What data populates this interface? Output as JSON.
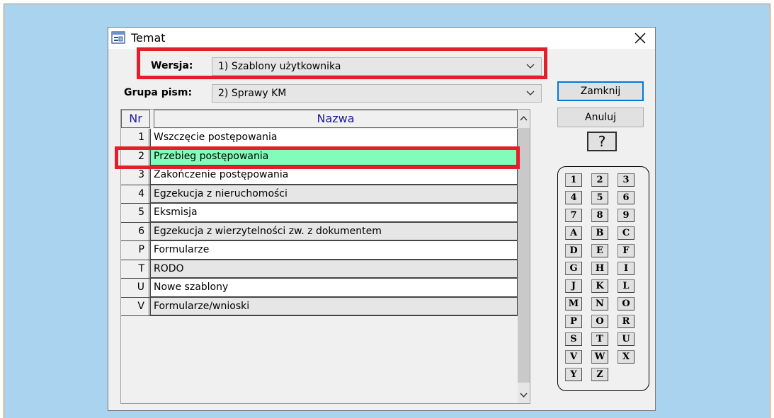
{
  "window": {
    "title": "Temat"
  },
  "wersja": {
    "label": "Wersja:",
    "value": "1)  Szablony użytkownika"
  },
  "grupa": {
    "label": "Grupa pism:",
    "value": "2)  Sprawy KM"
  },
  "table": {
    "headers": {
      "nr": "Nr",
      "name": "Nazwa"
    },
    "rows": [
      {
        "nr": "1",
        "name": "Wszczęcie postępowania"
      },
      {
        "nr": "2",
        "name": "Przebieg postępowania",
        "selected": true
      },
      {
        "nr": "3",
        "name": "Zakończenie postępowania"
      },
      {
        "nr": "4",
        "name": "Egzekucja z nieruchomości"
      },
      {
        "nr": "5",
        "name": "Eksmisja"
      },
      {
        "nr": "6",
        "name": "Egzekucja z wierzytelności zw. z dokumentem"
      },
      {
        "nr": "P",
        "name": "Formularze"
      },
      {
        "nr": "T",
        "name": "RODO"
      },
      {
        "nr": "U",
        "name": "Nowe szablony"
      },
      {
        "nr": "V",
        "name": "Formularze/wnioski"
      }
    ]
  },
  "buttons": {
    "zamknij": "Zamknij",
    "anuluj": "Anuluj",
    "help": "?"
  },
  "letters": [
    "1",
    "2",
    "3",
    "4",
    "5",
    "6",
    "7",
    "8",
    "9",
    "A",
    "B",
    "C",
    "D",
    "E",
    "F",
    "G",
    "H",
    "I",
    "J",
    "K",
    "L",
    "M",
    "N",
    "O",
    "P",
    "O",
    "R",
    "S",
    "T",
    "U",
    "V",
    "W",
    "X",
    "Y",
    "Z"
  ],
  "colors": {
    "selected_row": "#82fcb9",
    "highlight_box": "#e3202a",
    "header_text": "#1a1aa0",
    "background": "#a9d3ef",
    "frame_border": "#e8832a"
  },
  "icons": {
    "app": "window-app-icon",
    "close": "close-icon",
    "dropdown": "chevron-down-icon"
  }
}
